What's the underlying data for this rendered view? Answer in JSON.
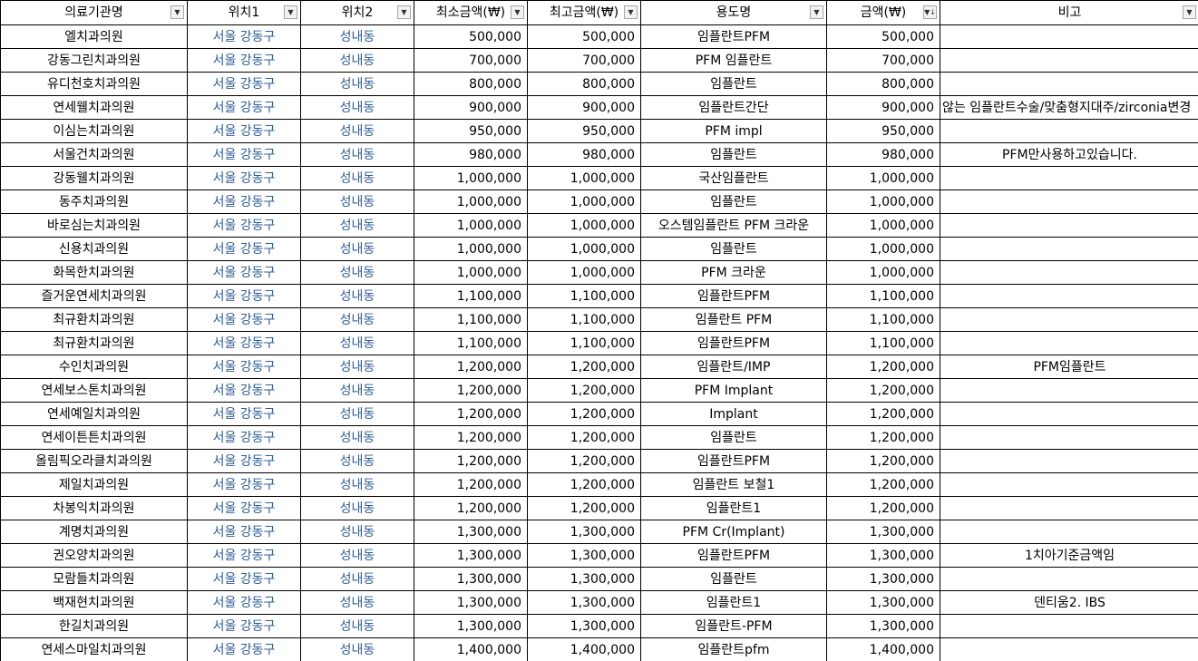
{
  "headers": [
    {
      "label": "의료기관명",
      "filter": "▼"
    },
    {
      "label": "위치1",
      "filter": "▼"
    },
    {
      "label": "위치2",
      "filter": "▼"
    },
    {
      "label": "최소금액(₩)",
      "filter": "▼"
    },
    {
      "label": "최고금액(₩)",
      "filter": "▼"
    },
    {
      "label": "용도명",
      "filter": "▼"
    },
    {
      "label": "금액(₩)",
      "filter": "▼↓"
    },
    {
      "label": "비고",
      "filter": "▼"
    }
  ],
  "rows": [
    [
      "엘치과의원",
      "서울 강동구",
      "성내동",
      "500,000",
      "500,000",
      "임플란트PFM",
      "500,000",
      ""
    ],
    [
      "강동그린치과의원",
      "서울 강동구",
      "성내동",
      "700,000",
      "700,000",
      "PFM 임플란트",
      "700,000",
      ""
    ],
    [
      "유디천호치과의원",
      "서울 강동구",
      "성내동",
      "800,000",
      "800,000",
      "임플란트",
      "800,000",
      ""
    ],
    [
      "연세웰치과의원",
      "서울 강동구",
      "성내동",
      "900,000",
      "900,000",
      "임플란트간단",
      "900,000",
      "않는 임플란트수술/맞춤형지대주/zirconia변경"
    ],
    [
      "이심는치과의원",
      "서울 강동구",
      "성내동",
      "950,000",
      "950,000",
      "PFM impl",
      "950,000",
      ""
    ],
    [
      "서울건치과의원",
      "서울 강동구",
      "성내동",
      "980,000",
      "980,000",
      "임플란트",
      "980,000",
      "PFM만사용하고있습니다."
    ],
    [
      "강동웰치과의원",
      "서울 강동구",
      "성내동",
      "1,000,000",
      "1,000,000",
      "국산임플란트",
      "1,000,000",
      ""
    ],
    [
      "동주치과의원",
      "서울 강동구",
      "성내동",
      "1,000,000",
      "1,000,000",
      "임플란트",
      "1,000,000",
      ""
    ],
    [
      "바로심는치과의원",
      "서울 강동구",
      "성내동",
      "1,000,000",
      "1,000,000",
      "오스템임플란트 PFM 크라운",
      "1,000,000",
      ""
    ],
    [
      "신용치과의원",
      "서울 강동구",
      "성내동",
      "1,000,000",
      "1,000,000",
      "임플란트",
      "1,000,000",
      ""
    ],
    [
      "화목한치과의원",
      "서울 강동구",
      "성내동",
      "1,000,000",
      "1,000,000",
      "PFM 크라운",
      "1,000,000",
      ""
    ],
    [
      "즐거운연세치과의원",
      "서울 강동구",
      "성내동",
      "1,100,000",
      "1,100,000",
      "임플란트PFM",
      "1,100,000",
      ""
    ],
    [
      "최규환치과의원",
      "서울 강동구",
      "성내동",
      "1,100,000",
      "1,100,000",
      "임플란트 PFM",
      "1,100,000",
      ""
    ],
    [
      "최규환치과의원",
      "서울 강동구",
      "성내동",
      "1,100,000",
      "1,100,000",
      "임플란트PFM",
      "1,100,000",
      ""
    ],
    [
      "수인치과의원",
      "서울 강동구",
      "성내동",
      "1,200,000",
      "1,200,000",
      "임플란트/IMP",
      "1,200,000",
      "PFM임플란트"
    ],
    [
      "연세보스톤치과의원",
      "서울 강동구",
      "성내동",
      "1,200,000",
      "1,200,000",
      "PFM Implant",
      "1,200,000",
      ""
    ],
    [
      "연세예일치과의원",
      "서울 강동구",
      "성내동",
      "1,200,000",
      "1,200,000",
      "Implant",
      "1,200,000",
      ""
    ],
    [
      "연세이튼튼치과의원",
      "서울 강동구",
      "성내동",
      "1,200,000",
      "1,200,000",
      "임플란트",
      "1,200,000",
      ""
    ],
    [
      "올림픽오라클치과의원",
      "서울 강동구",
      "성내동",
      "1,200,000",
      "1,200,000",
      "임플란트PFM",
      "1,200,000",
      ""
    ],
    [
      "제일치과의원",
      "서울 강동구",
      "성내동",
      "1,200,000",
      "1,200,000",
      "임플란트 보철1",
      "1,200,000",
      ""
    ],
    [
      "차봉익치과의원",
      "서울 강동구",
      "성내동",
      "1,200,000",
      "1,200,000",
      "임플란트1",
      "1,200,000",
      ""
    ],
    [
      "계명치과의원",
      "서울 강동구",
      "성내동",
      "1,300,000",
      "1,300,000",
      "PFM Cr(Implant)",
      "1,300,000",
      ""
    ],
    [
      "권오양치과의원",
      "서울 강동구",
      "성내동",
      "1,300,000",
      "1,300,000",
      "임플란트PFM",
      "1,300,000",
      "1치아기준금액임"
    ],
    [
      "모람들치과의원",
      "서울 강동구",
      "성내동",
      "1,300,000",
      "1,300,000",
      "임플란트",
      "1,300,000",
      ""
    ],
    [
      "백재현치과의원",
      "서울 강동구",
      "성내동",
      "1,300,000",
      "1,300,000",
      "임플란트1",
      "1,300,000",
      "덴티움2. IBS"
    ],
    [
      "한길치과의원",
      "서울 강동구",
      "성내동",
      "1,300,000",
      "1,300,000",
      "임플란트-PFM",
      "1,300,000",
      ""
    ],
    [
      "연세스마일치과의원",
      "서울 강동구",
      "성내동",
      "1,400,000",
      "1,400,000",
      "임플란트pfm",
      "1,400,000",
      ""
    ]
  ]
}
